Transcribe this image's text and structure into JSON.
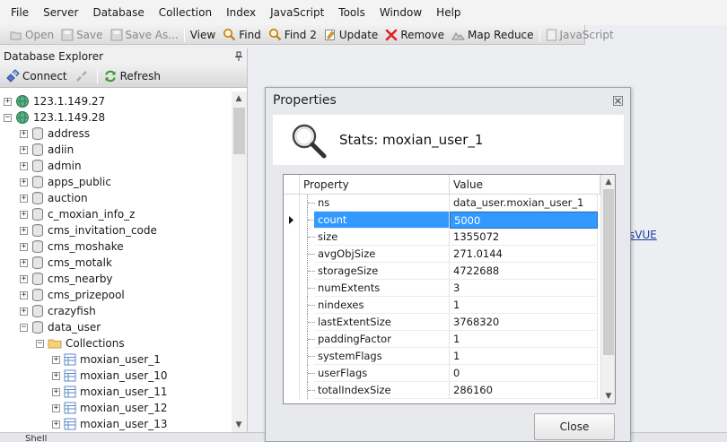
{
  "menubar": [
    "File",
    "Server",
    "Database",
    "Collection",
    "Index",
    "JavaScript",
    "Tools",
    "Window",
    "Help"
  ],
  "toolbar": {
    "open": "Open",
    "save": "Save",
    "save_as": "Save As...",
    "view": "View",
    "find": "Find",
    "find2": "Find 2",
    "update": "Update",
    "remove": "Remove",
    "map_reduce": "Map Reduce",
    "javascript": "JavaScript"
  },
  "explorer": {
    "title": "Database Explorer",
    "pin": "ᵖ",
    "connect": "Connect",
    "refresh": "Refresh",
    "servers": [
      "123.1.149.27",
      "123.1.149.28"
    ],
    "databases": [
      "address",
      "adiin",
      "admin",
      "apps_public",
      "auction",
      "c_moxian_info_z",
      "cms_invitation_code",
      "cms_moshake",
      "cms_motalk",
      "cms_nearby",
      "cms_prizepool",
      "crazyfish",
      "data_user"
    ],
    "collections_folder": "Collections",
    "collections": [
      "moxian_user_1",
      "moxian_user_10",
      "moxian_user_11",
      "moxian_user_12",
      "moxian_user_13"
    ]
  },
  "bottom": {
    "shell": "Shell"
  },
  "background_link": "sVUE",
  "dialog": {
    "title": "Properties",
    "stats_title": "Stats: moxian_user_1",
    "columns": [
      "Property",
      "Value"
    ],
    "rows": [
      {
        "property": "ns",
        "value": "data_user.moxian_user_1"
      },
      {
        "property": "count",
        "value": "5000"
      },
      {
        "property": "size",
        "value": "1355072"
      },
      {
        "property": "avgObjSize",
        "value": "271.0144"
      },
      {
        "property": "storageSize",
        "value": "4722688"
      },
      {
        "property": "numExtents",
        "value": "3"
      },
      {
        "property": "nindexes",
        "value": "1"
      },
      {
        "property": "lastExtentSize",
        "value": "3768320"
      },
      {
        "property": "paddingFactor",
        "value": "1"
      },
      {
        "property": "systemFlags",
        "value": "1"
      },
      {
        "property": "userFlags",
        "value": "0"
      },
      {
        "property": "totalIndexSize",
        "value": "286160"
      }
    ],
    "selected_property": "count",
    "close": "Close"
  },
  "colors": {
    "selection": "#3399ff",
    "link": "#1a3fa0"
  }
}
